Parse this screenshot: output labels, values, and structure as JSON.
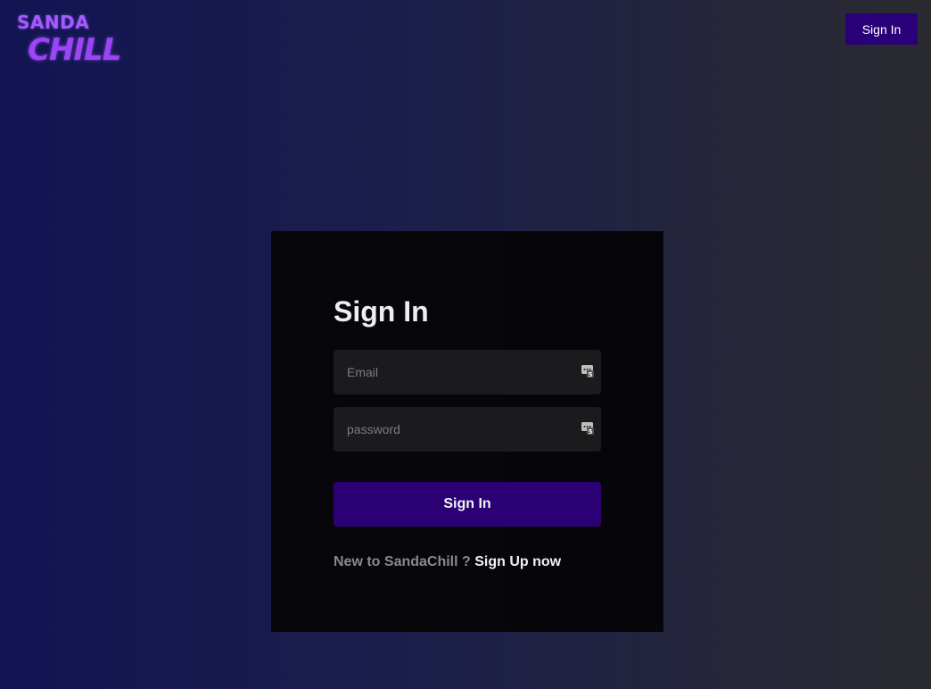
{
  "logo": {
    "line1": "SANDA",
    "line2": "CHILL"
  },
  "header": {
    "signin_label": "Sign In"
  },
  "form": {
    "title": "Sign In",
    "email_placeholder": "Email",
    "email_value": "",
    "password_placeholder": "password",
    "password_value": "",
    "submit_label": "Sign In",
    "signup_prompt": "New to SandaChill ?",
    "signup_link": "Sign Up now",
    "password_manager_icon": "password-manager-icon"
  },
  "colors": {
    "accent": "#2a0078",
    "logo": "#a35bff",
    "card_bg": "#050508",
    "input_bg": "#1b1b1d"
  }
}
